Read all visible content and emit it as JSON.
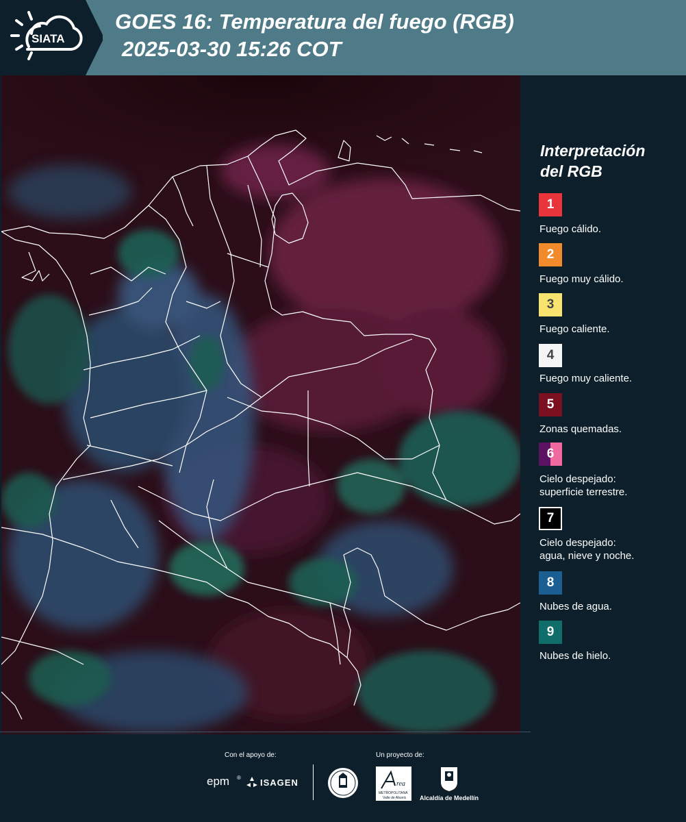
{
  "header": {
    "logo_text": "SIATA",
    "title_line1": "GOES 16: Temperatura del fuego (RGB)",
    "title_line2": "2025-03-30 15:26 COT"
  },
  "legend": {
    "title_line1": "Interpretación",
    "title_line2": "del RGB",
    "items": [
      {
        "num": "1",
        "label": "Fuego cálido.",
        "color": "#e8343a"
      },
      {
        "num": "2",
        "label": "Fuego muy cálido.",
        "color": "#f08a2a"
      },
      {
        "num": "3",
        "label": "Fuego caliente.",
        "color": "#f7e36d",
        "text_color": "#444444"
      },
      {
        "num": "4",
        "label": "Fuego muy caliente.",
        "color": "#f5f5f5",
        "text_color": "#444444"
      },
      {
        "num": "5",
        "label": "Zonas quemadas.",
        "color": "#7a1020"
      },
      {
        "num": "6",
        "label_line1": "Cielo despejado:",
        "label_line2": "superficie terrestre.",
        "color_left": "#5b1260",
        "color_right": "#f06aa0"
      },
      {
        "num": "7",
        "label_line1": "Cielo despejado:",
        "label_line2": "agua, nieve y noche.",
        "color": "#000000"
      },
      {
        "num": "8",
        "label": "Nubes de agua.",
        "color": "#1b5f92"
      },
      {
        "num": "9",
        "label": "Nubes de hielo.",
        "color": "#0f6e6a"
      }
    ]
  },
  "footer": {
    "support_label": "Con el apoyo de:",
    "project_label": "Un proyecto de:",
    "sponsors": [
      "epm",
      "ISAGEN"
    ],
    "partners": [
      "Universidad Nacional",
      "Área Metropolitana",
      "Alcaldía de Medellín"
    ],
    "area_line1": "METROPOLITANA",
    "area_line2": "Valle de Aburrá",
    "alcaldia_label": "Alcaldía de Medellín"
  }
}
